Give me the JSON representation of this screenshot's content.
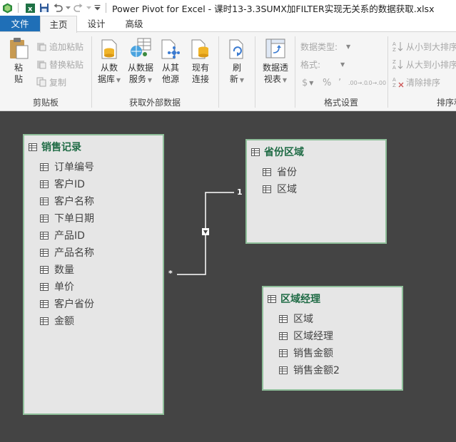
{
  "window": {
    "title": "Power Pivot for Excel - 课时13-3.3SUMX加FILTER实现无关系的数据获取.xlsx",
    "accent_color": "#1f6fb7"
  },
  "tabs": [
    {
      "label": "文件"
    },
    {
      "label": "主页"
    },
    {
      "label": "设计"
    },
    {
      "label": "高级"
    }
  ],
  "ribbon": {
    "clipboard": {
      "label": "剪贴板",
      "paste_line1": "粘",
      "paste_line2": "贴",
      "append_paste": "追加粘贴",
      "replace_paste": "替换粘贴",
      "copy": "复制"
    },
    "external": {
      "label": "获取外部数据",
      "from_db_line1": "从数",
      "from_db_line2": "据库",
      "from_service_line1": "从数据",
      "from_service_line2": "服务",
      "from_other_line1": "从其",
      "from_other_line2": "他源",
      "existing_line1": "现有",
      "existing_line2": "连接"
    },
    "refresh": {
      "line1": "刷",
      "line2": "新"
    },
    "pivot": {
      "line1": "数据透",
      "line2": "视表"
    },
    "format": {
      "label": "格式设置",
      "data_type": "数据类型:",
      "format": "格式:",
      "currency": "$",
      "percent": "%",
      "comma": "’",
      "inc_dec": ".00→.0",
      "dec_dec": ".0→.00"
    },
    "sort": {
      "label": "排序和",
      "asc": "从小到大排序",
      "desc": "从大到小排序",
      "clear": "清除排序"
    }
  },
  "diagram": {
    "tables": [
      {
        "name": "销售记录",
        "columns": [
          "订单编号",
          "客户ID",
          "客户名称",
          "下单日期",
          "产品ID",
          "产品名称",
          "数量",
          "单价",
          "客户省份",
          "金额"
        ]
      },
      {
        "name": "省份区域",
        "columns": [
          "省份",
          "区域"
        ]
      },
      {
        "name": "区域经理",
        "columns": [
          "区域",
          "区域经理",
          "销售金额",
          "销售金额2"
        ]
      }
    ],
    "relationship": {
      "one_label": "1",
      "many_label": "*"
    }
  }
}
